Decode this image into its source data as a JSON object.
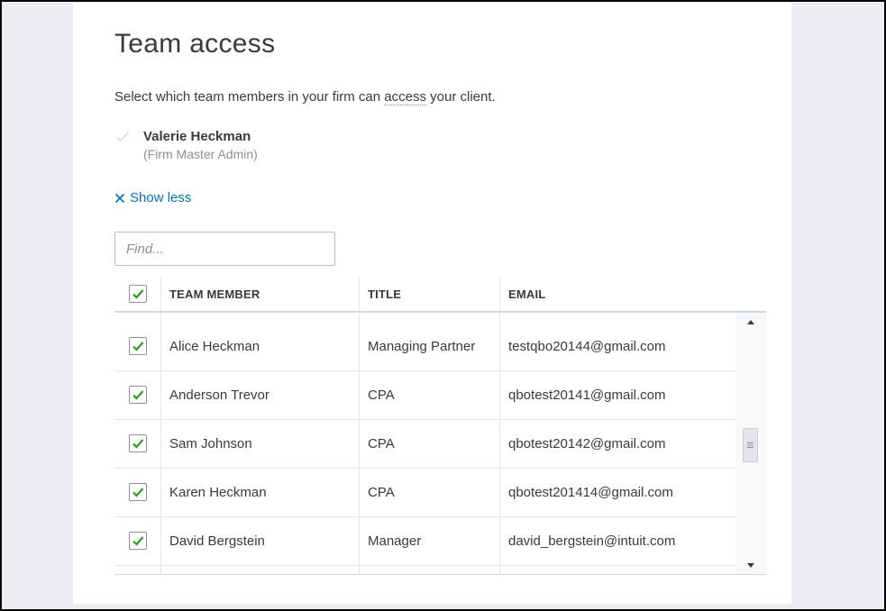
{
  "page": {
    "title": "Team access",
    "subtitle_before": "Select which team members in your firm can ",
    "subtitle_link": "access",
    "subtitle_after": " your client."
  },
  "admin": {
    "name": "Valerie Heckman",
    "role": "(Firm Master Admin)",
    "checked": true,
    "disabled": true
  },
  "toggle": {
    "label": "Show less",
    "icon": "close-icon"
  },
  "search": {
    "placeholder": "Find...",
    "value": ""
  },
  "table": {
    "select_all_checked": true,
    "headers": {
      "member": "TEAM MEMBER",
      "title": "TITLE",
      "email": "EMAIL"
    },
    "rows": [
      {
        "name": "Alice Heckman",
        "title": "Managing Partner",
        "email": "testqbo20144@gmail.com",
        "checked": true
      },
      {
        "name": "Anderson Trevor",
        "title": "CPA",
        "email": "qbotest20141@gmail.com",
        "checked": true
      },
      {
        "name": "Sam Johnson",
        "title": "CPA",
        "email": "qbotest20142@gmail.com",
        "checked": true
      },
      {
        "name": "Karen Heckman",
        "title": "CPA",
        "email": "qbotest201414@gmail.com",
        "checked": true
      },
      {
        "name": "David Bergstein",
        "title": "Manager",
        "email": "david_bergstein@intuit.com",
        "checked": true
      }
    ]
  },
  "colors": {
    "accent": "#0077c5",
    "check": "#2ca01c",
    "text": "#393a3d",
    "muted": "#8d9096",
    "background": "#eceef1"
  }
}
